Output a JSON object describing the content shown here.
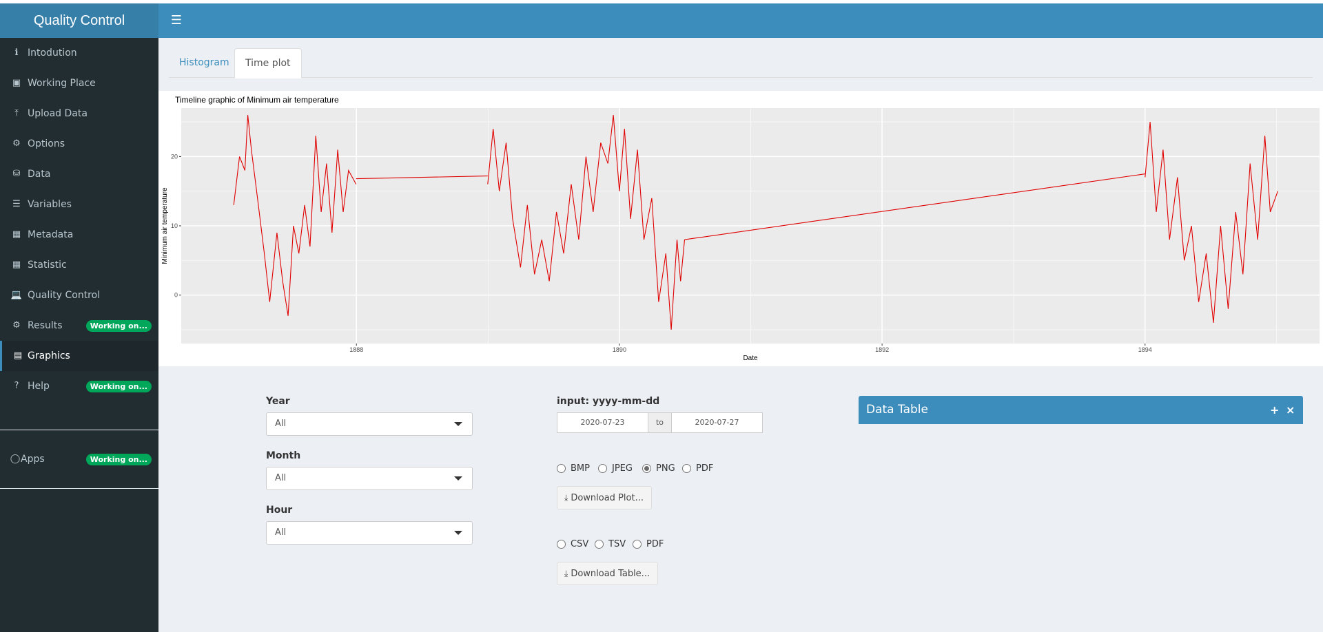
{
  "app": {
    "title": "Quality Control"
  },
  "navbar": {
    "toggle_icon": "hamburger-icon"
  },
  "sidebar": {
    "items": [
      {
        "label": "Intodution",
        "icon": "info-icon"
      },
      {
        "label": "Working Place",
        "icon": "briefcase-icon"
      },
      {
        "label": "Upload Data",
        "icon": "upload-icon"
      },
      {
        "label": "Options",
        "icon": "gears-icon"
      },
      {
        "label": "Data",
        "icon": "database-icon"
      },
      {
        "label": "Variables",
        "icon": "list-icon"
      },
      {
        "label": "Metadata",
        "icon": "table-icon"
      },
      {
        "label": "Statistic",
        "icon": "table-icon"
      },
      {
        "label": "Quality Control",
        "icon": "laptop-icon"
      },
      {
        "label": "Results",
        "icon": "gears-icon",
        "badge": "Working on..."
      },
      {
        "label": "Graphics",
        "icon": "area-chart-icon",
        "active": true
      },
      {
        "label": "Help",
        "icon": "question-icon",
        "badge": "Working on..."
      }
    ],
    "apps": {
      "label": "Apps",
      "icon": "lightbulb-icon",
      "badge": "Working on..."
    },
    "badge_color": "#00a65a"
  },
  "tabs": [
    {
      "label": "Histogram",
      "active": false
    },
    {
      "label": "Time plot",
      "active": true
    }
  ],
  "chart_data": {
    "type": "line",
    "title": "Timeline graphic of Minimum air temperature",
    "xlabel": "Date",
    "ylabel": "Minimum air temperature",
    "x_ticks": [
      "1888",
      "1890",
      "1892",
      "1894"
    ],
    "y_ticks": [
      0,
      10,
      20
    ],
    "xlim": [
      "1886-09-01",
      "1895-05-01"
    ],
    "ylim": [
      -7,
      27
    ],
    "line_color": "#e00000",
    "grid": true,
    "series": [
      {
        "segments": [
          {
            "start": "1887-01-25",
            "end": "1887-12-31",
            "x": [
              "1887-01-25",
              "1887-02-10",
              "1887-02-25",
              "1887-03-05",
              "1887-03-15",
              "1887-04-01",
              "1887-04-20",
              "1887-05-05",
              "1887-05-25",
              "1887-06-10",
              "1887-06-25",
              "1887-07-10",
              "1887-07-25",
              "1887-08-10",
              "1887-08-25",
              "1887-09-10",
              "1887-09-25",
              "1887-10-10",
              "1887-10-25",
              "1887-11-10",
              "1887-11-25",
              "1887-12-10",
              "1887-12-31"
            ],
            "y": [
              13,
              20,
              18,
              26,
              21,
              14,
              6,
              -1,
              9,
              2,
              -3,
              10,
              6,
              13,
              7,
              23,
              12,
              19,
              9,
              21,
              12,
              18,
              16
            ]
          },
          {
            "start": "1887-12-31",
            "end": "1888-12-31",
            "x": [
              "1887-12-31",
              "1888-12-31"
            ],
            "y": [
              16.8,
              17.2
            ]
          },
          {
            "start": "1888-12-31",
            "end": "1890-07-01",
            "x": [
              "1888-12-31",
              "1889-01-15",
              "1889-02-01",
              "1889-02-20",
              "1889-03-10",
              "1889-04-01",
              "1889-04-20",
              "1889-05-10",
              "1889-05-30",
              "1889-06-20",
              "1889-07-10",
              "1889-07-30",
              "1889-08-20",
              "1889-09-10",
              "1889-09-30",
              "1889-10-20",
              "1889-11-10",
              "1889-11-30",
              "1889-12-15",
              "1890-01-01",
              "1890-01-15",
              "1890-02-01",
              "1890-02-20",
              "1890-03-10",
              "1890-04-01",
              "1890-04-20",
              "1890-05-10",
              "1890-05-25",
              "1890-06-10",
              "1890-06-20",
              "1890-07-01"
            ],
            "y": [
              16,
              24,
              15,
              22,
              11,
              4,
              13,
              3,
              8,
              2,
              12,
              6,
              16,
              8,
              20,
              12,
              22,
              19,
              26,
              15,
              24,
              11,
              21,
              8,
              14,
              -1,
              6,
              -5,
              8,
              2,
              8
            ]
          },
          {
            "start": "1890-07-01",
            "end": "1894-01-01",
            "x": [
              "1890-07-01",
              "1894-01-01"
            ],
            "y": [
              8,
              17.5
            ]
          },
          {
            "start": "1894-01-01",
            "end": "1895-01-05",
            "x": [
              "1894-01-01",
              "1894-01-15",
              "1894-02-01",
              "1894-02-20",
              "1894-03-10",
              "1894-04-01",
              "1894-04-20",
              "1894-05-10",
              "1894-05-30",
              "1894-06-20",
              "1894-07-10",
              "1894-07-30",
              "1894-08-20",
              "1894-09-10",
              "1894-09-30",
              "1894-10-20",
              "1894-11-10",
              "1894-11-30",
              "1894-12-15",
              "1895-01-05"
            ],
            "y": [
              17,
              25,
              12,
              21,
              8,
              17,
              5,
              10,
              -1,
              6,
              -4,
              10,
              -2,
              12,
              3,
              19,
              8,
              23,
              12,
              15
            ]
          }
        ]
      }
    ]
  },
  "filters": {
    "year": {
      "label": "Year",
      "value": "All"
    },
    "month": {
      "label": "Month",
      "value": "All"
    },
    "hour": {
      "label": "Hour",
      "value": "All"
    }
  },
  "daterange": {
    "label": "input: yyyy-mm-dd",
    "start": "2020-07-23",
    "separator": "to",
    "end": "2020-07-27"
  },
  "plot_formats": {
    "options": [
      "BMP",
      "JPEG",
      "PNG",
      "PDF"
    ],
    "selected": "PNG",
    "button_label": "Download Plot..."
  },
  "table_formats": {
    "options": [
      "CSV",
      "TSV",
      "PDF"
    ],
    "selected": null,
    "button_label": "Download Table..."
  },
  "data_table_box": {
    "title": "Data Table",
    "tools": [
      "+",
      "×"
    ],
    "header_color": "#3c8dbc"
  }
}
